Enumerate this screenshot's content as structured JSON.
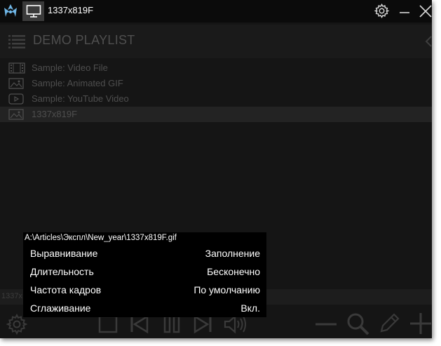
{
  "window": {
    "title": "1337x819F"
  },
  "playlist": {
    "title": "DEMO PLAYLIST",
    "items": [
      {
        "label": "Sample: Video File",
        "icon": "film-icon"
      },
      {
        "label": "Sample: Animated GIF",
        "icon": "image-icon"
      },
      {
        "label": "Sample: YouTube Video",
        "icon": "play-icon"
      },
      {
        "label": "1337x819F",
        "icon": "image-icon",
        "selected": true
      }
    ]
  },
  "status": {
    "text": "1337x"
  },
  "info": {
    "path": "A:\\Articles\\Экспл\\New_year\\1337x819F.gif",
    "rows": [
      {
        "key": "Выравнивание",
        "value": "Заполнение"
      },
      {
        "key": "Длительность",
        "value": "Бесконечно"
      },
      {
        "key": "Частота кадров",
        "value": "По умолчанию"
      },
      {
        "key": "Сглаживание",
        "value": "Вкл."
      }
    ]
  },
  "colors": {
    "window_bg": "#151515",
    "titlebar_bg": "#0b0b0b",
    "logo_accent": "#6fb6e6",
    "dim_text": "#4e4e4e",
    "popup_bg": "#000000"
  }
}
